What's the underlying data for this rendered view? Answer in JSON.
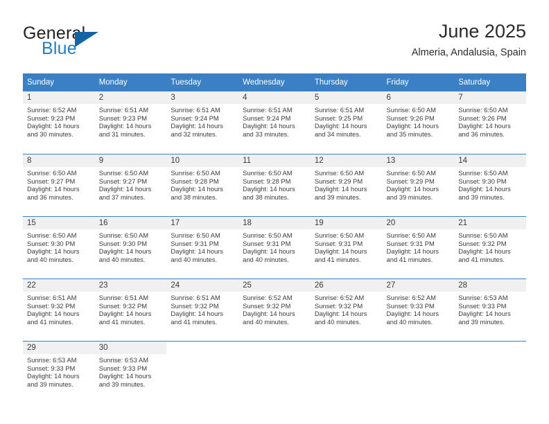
{
  "brand": {
    "name_top": "General",
    "name_bottom": "Blue",
    "logo_icon": "triangle-flag-icon",
    "accent_color": "#1464a5"
  },
  "header": {
    "title": "June 2025",
    "subtitle": "Almeria, Andalusia, Spain"
  },
  "theme": {
    "header_row_color": "#3b7fc4",
    "daynum_band_color": "#f0f0f0",
    "text_color": "#3a3a3a"
  },
  "calendar": {
    "weekday_headers": [
      "Sunday",
      "Monday",
      "Tuesday",
      "Wednesday",
      "Thursday",
      "Friday",
      "Saturday"
    ],
    "weeks": [
      [
        {
          "day": "1",
          "sunrise": "Sunrise: 6:52 AM",
          "sunset": "Sunset: 9:23 PM",
          "daylight_line1": "Daylight: 14 hours",
          "daylight_line2": "and 30 minutes."
        },
        {
          "day": "2",
          "sunrise": "Sunrise: 6:51 AM",
          "sunset": "Sunset: 9:23 PM",
          "daylight_line1": "Daylight: 14 hours",
          "daylight_line2": "and 31 minutes."
        },
        {
          "day": "3",
          "sunrise": "Sunrise: 6:51 AM",
          "sunset": "Sunset: 9:24 PM",
          "daylight_line1": "Daylight: 14 hours",
          "daylight_line2": "and 32 minutes."
        },
        {
          "day": "4",
          "sunrise": "Sunrise: 6:51 AM",
          "sunset": "Sunset: 9:24 PM",
          "daylight_line1": "Daylight: 14 hours",
          "daylight_line2": "and 33 minutes."
        },
        {
          "day": "5",
          "sunrise": "Sunrise: 6:51 AM",
          "sunset": "Sunset: 9:25 PM",
          "daylight_line1": "Daylight: 14 hours",
          "daylight_line2": "and 34 minutes."
        },
        {
          "day": "6",
          "sunrise": "Sunrise: 6:50 AM",
          "sunset": "Sunset: 9:26 PM",
          "daylight_line1": "Daylight: 14 hours",
          "daylight_line2": "and 35 minutes."
        },
        {
          "day": "7",
          "sunrise": "Sunrise: 6:50 AM",
          "sunset": "Sunset: 9:26 PM",
          "daylight_line1": "Daylight: 14 hours",
          "daylight_line2": "and 36 minutes."
        }
      ],
      [
        {
          "day": "8",
          "sunrise": "Sunrise: 6:50 AM",
          "sunset": "Sunset: 9:27 PM",
          "daylight_line1": "Daylight: 14 hours",
          "daylight_line2": "and 36 minutes."
        },
        {
          "day": "9",
          "sunrise": "Sunrise: 6:50 AM",
          "sunset": "Sunset: 9:27 PM",
          "daylight_line1": "Daylight: 14 hours",
          "daylight_line2": "and 37 minutes."
        },
        {
          "day": "10",
          "sunrise": "Sunrise: 6:50 AM",
          "sunset": "Sunset: 9:28 PM",
          "daylight_line1": "Daylight: 14 hours",
          "daylight_line2": "and 38 minutes."
        },
        {
          "day": "11",
          "sunrise": "Sunrise: 6:50 AM",
          "sunset": "Sunset: 9:28 PM",
          "daylight_line1": "Daylight: 14 hours",
          "daylight_line2": "and 38 minutes."
        },
        {
          "day": "12",
          "sunrise": "Sunrise: 6:50 AM",
          "sunset": "Sunset: 9:29 PM",
          "daylight_line1": "Daylight: 14 hours",
          "daylight_line2": "and 39 minutes."
        },
        {
          "day": "13",
          "sunrise": "Sunrise: 6:50 AM",
          "sunset": "Sunset: 9:29 PM",
          "daylight_line1": "Daylight: 14 hours",
          "daylight_line2": "and 39 minutes."
        },
        {
          "day": "14",
          "sunrise": "Sunrise: 6:50 AM",
          "sunset": "Sunset: 9:30 PM",
          "daylight_line1": "Daylight: 14 hours",
          "daylight_line2": "and 39 minutes."
        }
      ],
      [
        {
          "day": "15",
          "sunrise": "Sunrise: 6:50 AM",
          "sunset": "Sunset: 9:30 PM",
          "daylight_line1": "Daylight: 14 hours",
          "daylight_line2": "and 40 minutes."
        },
        {
          "day": "16",
          "sunrise": "Sunrise: 6:50 AM",
          "sunset": "Sunset: 9:30 PM",
          "daylight_line1": "Daylight: 14 hours",
          "daylight_line2": "and 40 minutes."
        },
        {
          "day": "17",
          "sunrise": "Sunrise: 6:50 AM",
          "sunset": "Sunset: 9:31 PM",
          "daylight_line1": "Daylight: 14 hours",
          "daylight_line2": "and 40 minutes."
        },
        {
          "day": "18",
          "sunrise": "Sunrise: 6:50 AM",
          "sunset": "Sunset: 9:31 PM",
          "daylight_line1": "Daylight: 14 hours",
          "daylight_line2": "and 40 minutes."
        },
        {
          "day": "19",
          "sunrise": "Sunrise: 6:50 AM",
          "sunset": "Sunset: 9:31 PM",
          "daylight_line1": "Daylight: 14 hours",
          "daylight_line2": "and 41 minutes."
        },
        {
          "day": "20",
          "sunrise": "Sunrise: 6:50 AM",
          "sunset": "Sunset: 9:31 PM",
          "daylight_line1": "Daylight: 14 hours",
          "daylight_line2": "and 41 minutes."
        },
        {
          "day": "21",
          "sunrise": "Sunrise: 6:50 AM",
          "sunset": "Sunset: 9:32 PM",
          "daylight_line1": "Daylight: 14 hours",
          "daylight_line2": "and 41 minutes."
        }
      ],
      [
        {
          "day": "22",
          "sunrise": "Sunrise: 6:51 AM",
          "sunset": "Sunset: 9:32 PM",
          "daylight_line1": "Daylight: 14 hours",
          "daylight_line2": "and 41 minutes."
        },
        {
          "day": "23",
          "sunrise": "Sunrise: 6:51 AM",
          "sunset": "Sunset: 9:32 PM",
          "daylight_line1": "Daylight: 14 hours",
          "daylight_line2": "and 41 minutes."
        },
        {
          "day": "24",
          "sunrise": "Sunrise: 6:51 AM",
          "sunset": "Sunset: 9:32 PM",
          "daylight_line1": "Daylight: 14 hours",
          "daylight_line2": "and 41 minutes."
        },
        {
          "day": "25",
          "sunrise": "Sunrise: 6:52 AM",
          "sunset": "Sunset: 9:32 PM",
          "daylight_line1": "Daylight: 14 hours",
          "daylight_line2": "and 40 minutes."
        },
        {
          "day": "26",
          "sunrise": "Sunrise: 6:52 AM",
          "sunset": "Sunset: 9:32 PM",
          "daylight_line1": "Daylight: 14 hours",
          "daylight_line2": "and 40 minutes."
        },
        {
          "day": "27",
          "sunrise": "Sunrise: 6:52 AM",
          "sunset": "Sunset: 9:33 PM",
          "daylight_line1": "Daylight: 14 hours",
          "daylight_line2": "and 40 minutes."
        },
        {
          "day": "28",
          "sunrise": "Sunrise: 6:53 AM",
          "sunset": "Sunset: 9:33 PM",
          "daylight_line1": "Daylight: 14 hours",
          "daylight_line2": "and 39 minutes."
        }
      ],
      [
        {
          "day": "29",
          "sunrise": "Sunrise: 6:53 AM",
          "sunset": "Sunset: 9:33 PM",
          "daylight_line1": "Daylight: 14 hours",
          "daylight_line2": "and 39 minutes."
        },
        {
          "day": "30",
          "sunrise": "Sunrise: 6:53 AM",
          "sunset": "Sunset: 9:33 PM",
          "daylight_line1": "Daylight: 14 hours",
          "daylight_line2": "and 39 minutes."
        },
        {
          "day": "",
          "sunrise": "",
          "sunset": "",
          "daylight_line1": "",
          "daylight_line2": ""
        },
        {
          "day": "",
          "sunrise": "",
          "sunset": "",
          "daylight_line1": "",
          "daylight_line2": ""
        },
        {
          "day": "",
          "sunrise": "",
          "sunset": "",
          "daylight_line1": "",
          "daylight_line2": ""
        },
        {
          "day": "",
          "sunrise": "",
          "sunset": "",
          "daylight_line1": "",
          "daylight_line2": ""
        },
        {
          "day": "",
          "sunrise": "",
          "sunset": "",
          "daylight_line1": "",
          "daylight_line2": ""
        }
      ]
    ]
  }
}
